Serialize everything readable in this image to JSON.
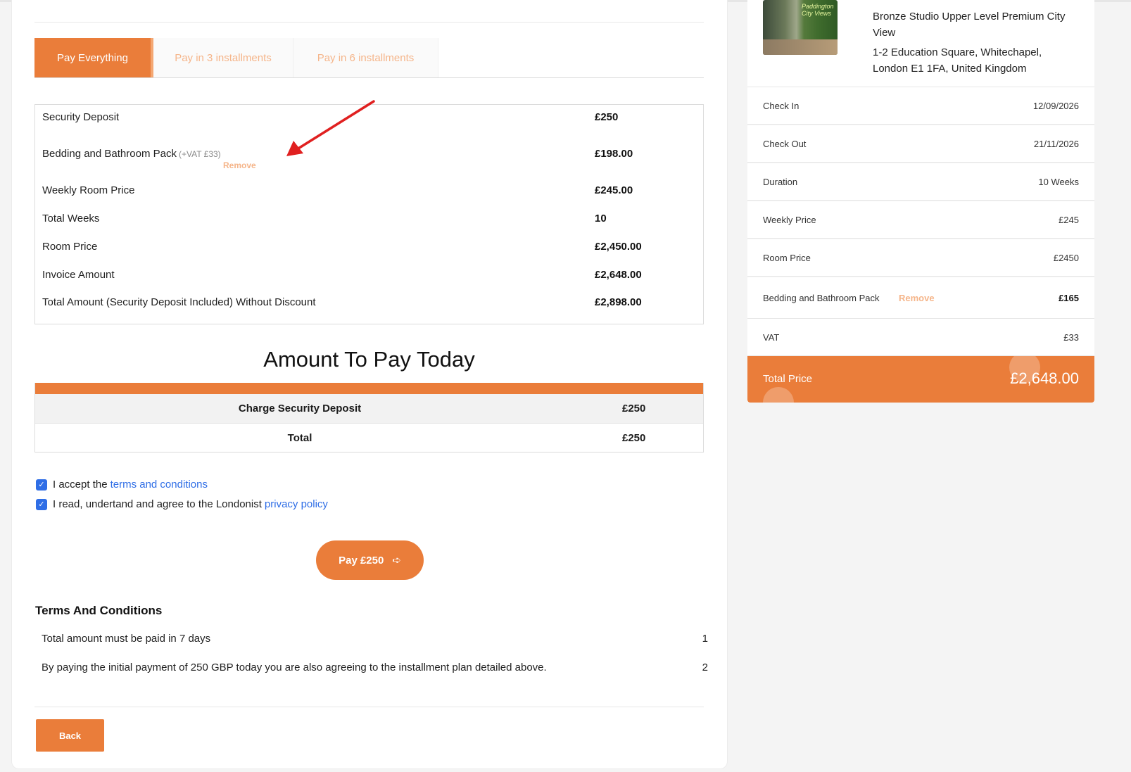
{
  "payment_tabs": [
    {
      "label": "Pay Everything",
      "active": true
    },
    {
      "label": "Pay in 3 installments",
      "active": false
    },
    {
      "label": "Pay in 6 installments",
      "active": false
    }
  ],
  "price_breakdown": {
    "security_deposit": {
      "label": "Security Deposit",
      "value": "£250"
    },
    "bedding": {
      "label": "Bedding and Bathroom Pack",
      "vat_note": "(+VAT £33)",
      "value": "£198.00",
      "remove_label": "Remove"
    },
    "weekly_room_price": {
      "label": "Weekly Room Price",
      "value": "£245.00"
    },
    "total_weeks": {
      "label": "Total Weeks",
      "value": "10"
    },
    "room_price": {
      "label": "Room Price",
      "value": "£2,450.00"
    },
    "invoice_amount": {
      "label": "Invoice Amount",
      "value": "£2,648.00"
    },
    "total_amount": {
      "label": "Total Amount (Security Deposit Included) Without Discount",
      "value": "£2,898.00"
    }
  },
  "today": {
    "title": "Amount To Pay Today",
    "charge_label": "Charge Security Deposit",
    "charge_value": "£250",
    "total_label": "Total",
    "total_value": "£250"
  },
  "agreements": {
    "terms_prefix": "I accept the",
    "terms_link": "terms and conditions",
    "privacy_prefix": "I read, undertand and agree to the Londonist",
    "privacy_link": "privacy policy",
    "terms_checked": true,
    "privacy_checked": true
  },
  "pay_button": {
    "label": "Pay £250"
  },
  "terms": {
    "title": "Terms And Conditions",
    "items": [
      {
        "text": "Total amount must be paid in 7 days",
        "num": "1"
      },
      {
        "text": "By paying the initial payment of 250 GBP today you are also agreeing to the installment plan detailed above.",
        "num": "2"
      }
    ]
  },
  "back_button": {
    "label": "Back"
  },
  "summary": {
    "property_title": "Bronze Studio Upper Level Premium City View",
    "address": "1-2 Education Square, Whitechapel, London E1 1FA, United Kingdom",
    "thumb_sign": "Paddington City Views",
    "rows": {
      "check_in": {
        "label": "Check In",
        "value": "12/09/2026"
      },
      "check_out": {
        "label": "Check Out",
        "value": "21/11/2026"
      },
      "duration": {
        "label": "Duration",
        "value": "10 Weeks"
      },
      "weekly_price": {
        "label": "Weekly Price",
        "value": "£245"
      },
      "room_price": {
        "label": "Room Price",
        "value": "£2450"
      },
      "bedding": {
        "label": "Bedding and Bathroom Pack",
        "remove_label": "Remove",
        "value": "£165"
      },
      "vat": {
        "label": "VAT",
        "value": "£33"
      }
    },
    "total_label": "Total Price",
    "total_value": "£2,648.00"
  },
  "colors": {
    "accent_orange": "#ea7d3a",
    "muted_orange": "#f5b58a",
    "link_blue": "#2f6ee6",
    "annotation_arrow": "#e02020"
  },
  "icons": {
    "pay_button_icon": "arrow-right-circle-icon",
    "checkbox_icon": "checkmark-icon",
    "annotation": "red-arrow-annotation"
  }
}
